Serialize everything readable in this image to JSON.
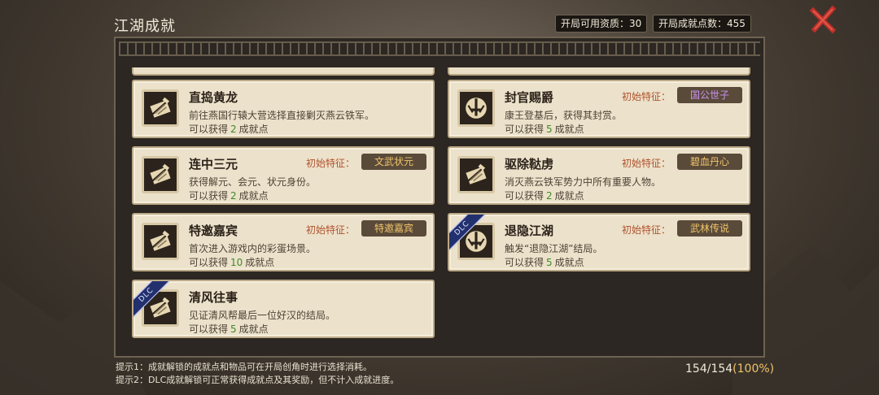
{
  "header": {
    "title": "江湖成就"
  },
  "stats": {
    "available_points": "开局可用资质：30",
    "achievement_points": "开局成就点数：455"
  },
  "close_icon": "close-icon",
  "achievements": [
    {
      "name": "直捣黄龙",
      "desc": "前往燕国行辕大营选择直接剿灭燕云铁军。",
      "reward_prefix": "可以获得",
      "reward_num": "2",
      "reward_suffix": "成就点",
      "trait_label": "",
      "trait_value": "",
      "dlc": false
    },
    {
      "name": "封官赐爵",
      "desc": "康王登基后，获得其封赏。",
      "reward_prefix": "可以获得",
      "reward_num": "5",
      "reward_suffix": "成就点",
      "trait_label": "初始特征：",
      "trait_value": "国公世子",
      "dlc": false
    },
    {
      "name": "连中三元",
      "desc": "获得解元、会元、状元身份。",
      "reward_prefix": "可以获得",
      "reward_num": "2",
      "reward_suffix": "成就点",
      "trait_label": "初始特征：",
      "trait_value": "文武状元",
      "dlc": false
    },
    {
      "name": "驱除鞑虏",
      "desc": "消灭燕云铁军势力中所有重要人物。",
      "reward_prefix": "可以获得",
      "reward_num": "2",
      "reward_suffix": "成就点",
      "trait_label": "初始特征：",
      "trait_value": "碧血丹心",
      "dlc": false
    },
    {
      "name": "特邀嘉宾",
      "desc": "首次进入游戏内的彩蛋场景。",
      "reward_prefix": "可以获得",
      "reward_num": "10",
      "reward_suffix": "成就点",
      "trait_label": "初始特征：",
      "trait_value": "特邀嘉宾",
      "dlc": false
    },
    {
      "name": "退隐江湖",
      "desc": "触发“退隐江湖”结局。",
      "reward_prefix": "可以获得",
      "reward_num": "5",
      "reward_suffix": "成就点",
      "trait_label": "初始特征：",
      "trait_value": "武林传说",
      "dlc": true
    },
    {
      "name": "清风往事",
      "desc": "见证清风帮最后一位好汉的结局。",
      "reward_prefix": "可以获得",
      "reward_num": "5",
      "reward_suffix": "成就点",
      "trait_label": "",
      "trait_value": "",
      "dlc": true
    }
  ],
  "dlc_badge": "DLC",
  "hints": [
    "提示1：成就解锁的成就点和物品可在开局创角时进行选择消耗。",
    "提示2：DLC成就解锁可正常获得成就点及其奖励，但不计入成就进度。"
  ],
  "progress": {
    "count": "154/154",
    "percent": "(100%)"
  }
}
